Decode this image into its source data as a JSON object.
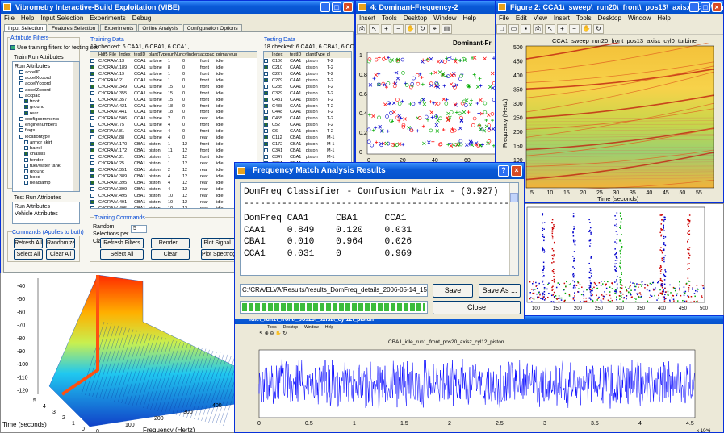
{
  "vibe": {
    "title": "Vibrometry Interactive-Build Exploitation (VIBE)",
    "menu": [
      "File",
      "Help",
      "Input Selection",
      "Experiments",
      "Debug"
    ],
    "tabs": [
      "Input Selection",
      "Features Selection",
      "Experiments",
      "Online Analysis",
      "Configuration Options"
    ],
    "attr_filters": "Attribute Filters",
    "use_training": "Use training filters for testing set",
    "train_run_attrs": "Train Run Attributes",
    "run_attributes": "Run Attributes",
    "tree": [
      "accelID",
      "accelXcoord",
      "accelYcoord",
      "accelZcoord",
      "accpac",
      "front",
      "ground",
      "rear",
      "configcomments",
      "enginenumbers",
      "flags",
      "locationtype",
      "armor skirt",
      "barrel",
      "chassis",
      "fender",
      "fuel/water tank",
      "ground",
      "hood",
      "headlamp"
    ],
    "test_run_attrs": "Test Run Attributes",
    "vehicle_attributes": "Vehicle Attributes",
    "commands": "Commands (Applies to both)",
    "refresh_all": "Refresh All",
    "randomize": "Randomize",
    "select_all": "Select All",
    "clear_all": "Clear All",
    "training_data": "Training Data",
    "training_checked": "18 checked:   6 CAA1,  6 CBA1,  6 CCA1,",
    "training_headers": [
      "",
      "Hdf5 File",
      "Index",
      "testID",
      "plantType",
      "runNum",
      "cylinders",
      "accpac",
      "primaryrun"
    ],
    "training_rows": [
      [
        "C:/CRA/V...",
        "13",
        "CCA1",
        "turbine",
        "1",
        "0",
        "front",
        "idle"
      ],
      [
        "C:/CRA/V...",
        "189",
        "CCA1",
        "turbine",
        "8",
        "0",
        "front",
        "idle"
      ],
      [
        "C:/CRA/V...",
        "19",
        "CCA1",
        "turbine",
        "1",
        "0",
        "front",
        "idle"
      ],
      [
        "C:/CRA/V...",
        "21",
        "CCA1",
        "turbine",
        "1",
        "0",
        "front",
        "idle"
      ],
      [
        "C:/CRA/V...",
        "349",
        "CCA1",
        "turbine",
        "15",
        "0",
        "front",
        "idle"
      ],
      [
        "C:/CRA/V...",
        "355",
        "CCA1",
        "turbine",
        "15",
        "0",
        "front",
        "idle"
      ],
      [
        "C:/CRA/V...",
        "357",
        "CCA1",
        "turbine",
        "15",
        "0",
        "front",
        "idle"
      ],
      [
        "C:/CRA/V...",
        "421",
        "CCA1",
        "turbine",
        "18",
        "0",
        "front",
        "idle"
      ],
      [
        "C:/CRA/V...",
        "441",
        "CCA1",
        "turbine",
        "18",
        "0",
        "front",
        "idle"
      ],
      [
        "C:/CRA/V...",
        "506",
        "CCA1",
        "turbine",
        "2",
        "0",
        "rear",
        "idle"
      ],
      [
        "C:/CRA/V...",
        "75",
        "CCA1",
        "turbine",
        "4",
        "0",
        "front",
        "idle"
      ],
      [
        "C:/CRA/V...",
        "81",
        "CCA1",
        "turbine",
        "4",
        "0",
        "front",
        "idle"
      ],
      [
        "C:/CRA/V...",
        "88",
        "CCA1",
        "turbine",
        "4",
        "0",
        "rear",
        "idle"
      ],
      [
        "C:/CRA/V...",
        "170",
        "CBA1",
        "piston",
        "1",
        "12",
        "front",
        "idle"
      ],
      [
        "C:/CRA/V...",
        "172",
        "CBA1",
        "piston",
        "11",
        "12",
        "front",
        "idle"
      ],
      [
        "C:/CRA/V...",
        "21",
        "CBA1",
        "piston",
        "1",
        "12",
        "front",
        "idle"
      ],
      [
        "C:/CRA/V...",
        "25",
        "CBA1",
        "piston",
        "1",
        "12",
        "rear",
        "idle"
      ],
      [
        "C:/CRA/V...",
        "351",
        "CBA1",
        "piston",
        "2",
        "12",
        "rear",
        "idle"
      ],
      [
        "C:/CRA/V...",
        "389",
        "CBA1",
        "piston",
        "4",
        "12",
        "rear",
        "idle"
      ],
      [
        "C:/CRA/V...",
        "395",
        "CBA1",
        "piston",
        "4",
        "12",
        "rear",
        "idle"
      ],
      [
        "C:/CRA/V...",
        "399",
        "CBA1",
        "piston",
        "4",
        "12",
        "rear",
        "idle"
      ],
      [
        "C:/CRA/V...",
        "495",
        "CBA1",
        "piston",
        "10",
        "12",
        "rear",
        "idle"
      ],
      [
        "C:/CRA/V...",
        "491",
        "CBA1",
        "piston",
        "10",
        "12",
        "rear",
        "idle"
      ],
      [
        "C:/CRA/V...",
        "495",
        "CBA1",
        "piston",
        "10",
        "12",
        "rear",
        "idle"
      ]
    ],
    "testing_data": "Testing Data",
    "testing_checked": "18 checked:   6 CAA1,  6 CBA1,  6 CCA1,",
    "testing_headers": [
      "",
      "Index",
      "testID",
      "plantType",
      "pl"
    ],
    "testing_rows": [
      [
        "C106",
        "CAA1",
        "piston",
        "T-2"
      ],
      [
        "C210",
        "CAA1",
        "piston",
        "T-2"
      ],
      [
        "C227",
        "CAA1",
        "piston",
        "T-2"
      ],
      [
        "C279",
        "CAA1",
        "piston",
        "T-2"
      ],
      [
        "C285",
        "CAA1",
        "piston",
        "T-2"
      ],
      [
        "C329",
        "CAA1",
        "piston",
        "T-2"
      ],
      [
        "C431",
        "CAA1",
        "piston",
        "T-2"
      ],
      [
        "C438",
        "CAA1",
        "piston",
        "T-2"
      ],
      [
        "C448",
        "CAA1",
        "piston",
        "T-2"
      ],
      [
        "C455",
        "CAA1",
        "piston",
        "T-2"
      ],
      [
        "C52",
        "CAA1",
        "piston",
        "T-2"
      ],
      [
        "C6",
        "CAA1",
        "piston",
        "T-2"
      ],
      [
        "C112",
        "CBA1",
        "piston",
        "M-1"
      ],
      [
        "C172",
        "CBA1",
        "piston",
        "M-1"
      ],
      [
        "C341",
        "CBA1",
        "piston",
        "M-1"
      ],
      [
        "C347",
        "CBA1",
        "piston",
        "M-1"
      ],
      [
        "C351",
        "CBA1",
        "piston",
        "M-1"
      ]
    ],
    "training_commands": "Training Commands",
    "random_selections": "Random Selections per Class",
    "random_value": "5",
    "refresh_filters": "Refresh Filters",
    "render": "Render...",
    "plot_signal": "Plot Signal...",
    "select_all2": "Select All",
    "clear": "Clear",
    "plot_spectrogram": "Plot Spectrogram..."
  },
  "fig4": {
    "title": "4: Dominant-Frequency-2",
    "menu": [
      "Insert",
      "Tools",
      "Desktop",
      "Window",
      "Help"
    ],
    "plot_title": "Dominant-Fr",
    "y_ticks": [
      "1",
      "0.8",
      "0.6",
      "0.4",
      "0.2",
      "0"
    ],
    "x_ticks": [
      "0",
      "20",
      "40",
      "60",
      "80"
    ]
  },
  "fig2": {
    "title": "Figure 2: CCA1\\_sweep\\_run20\\_front\\_pos13\\_axisx\\_cyl0\\_turbine",
    "menu": [
      "File",
      "Edit",
      "View",
      "Insert",
      "Tools",
      "Desktop",
      "Window",
      "Help"
    ],
    "plot_title": "CCA1_sweep_run20_front_pos13_axisx_cyl0_turbine",
    "ylabel": "Frequency (Hertz)",
    "xlabel": "Time (seconds)",
    "y_ticks": [
      "500",
      "450",
      "400",
      "350",
      "300",
      "250",
      "200",
      "150",
      "100",
      "50"
    ],
    "x_ticks": [
      "5",
      "10",
      "15",
      "20",
      "25",
      "30",
      "35",
      "40",
      "45",
      "50",
      "55"
    ]
  },
  "dialog": {
    "title": "Frequency Match Analysis Results",
    "lines": [
      "DomFreq Classifier - Confusion Matrix - (0.927)",
      "-------------------------------------------------",
      "DomFreq CAA1     CBA1     CCA1",
      "CAA1    0.849    0.120    0.031",
      "CBA1    0.010    0.964    0.026",
      "CCA1    0.031    0        0.969"
    ],
    "path": "C:/CRA/ELVA/Results/'results_DomFreq_details_2006-05-14_1502.txt",
    "save": "Save",
    "save_as": "Save As ...",
    "close": "Close",
    "progress": 1.0
  },
  "surface": {
    "z_ticks": [
      "-40",
      "-50",
      "-60",
      "-70",
      "-80",
      "-90",
      "-100",
      "-110",
      "-120"
    ],
    "t_ticks": [
      "5",
      "4",
      "3",
      "2",
      "1",
      "0"
    ],
    "f_ticks": [
      "0",
      "100",
      "200",
      "300",
      "400",
      "500"
    ],
    "t_label": "Time (seconds)",
    "f_label": "Frequency (Hertz)"
  },
  "signal": {
    "title": "idle\\_run1\\_front\\_pos20\\_axisz\\_cyl12\\_piston",
    "menu": [
      "Tools",
      "Desktop",
      "Window",
      "Help"
    ],
    "plot_title": "CBA1_idle_run1_front_pos20_axisz_cyl12_piston",
    "x_ticks": [
      "0",
      "0.5",
      "1",
      "1.5",
      "2",
      "2.5",
      "3",
      "3.5",
      "4",
      "4.5"
    ],
    "exp": "x 10^6"
  },
  "scatter2": {
    "y_ticks": [
      "0",
      "0",
      "0",
      "0",
      "0"
    ],
    "x_ticks": [
      "100",
      "150",
      "200",
      "250",
      "300",
      "350",
      "400",
      "450",
      "500"
    ]
  },
  "colors": {
    "title_blue": "#0552cc",
    "signal": "#0000ff",
    "progress": "#3cbc3c"
  }
}
